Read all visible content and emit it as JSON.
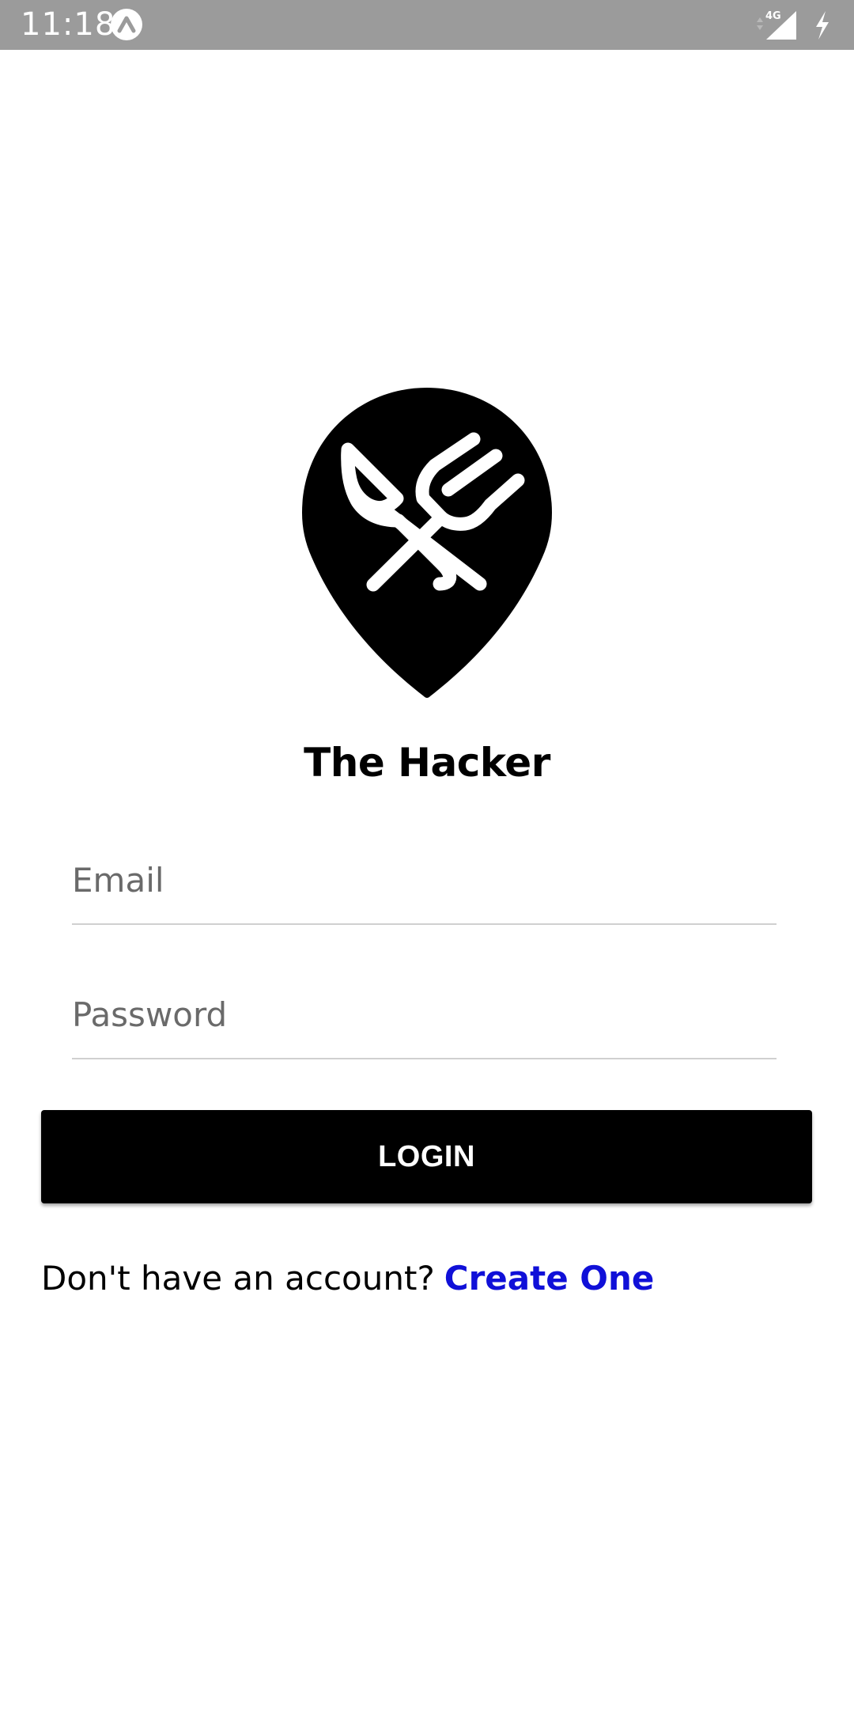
{
  "status_bar": {
    "time": "11:18",
    "network_label": "4G"
  },
  "app": {
    "title": "The Hacker"
  },
  "form": {
    "email_placeholder": "Email",
    "password_placeholder": "Password",
    "login_label": "LOGIN"
  },
  "signup": {
    "prompt": "Don't have an account?",
    "link_label": "Create One"
  },
  "colors": {
    "status_bar": "#9b9b9b",
    "primary": "#000000",
    "link": "#1010d8"
  },
  "icons": {
    "status_app": "expo-caret-icon",
    "network": "signal-4g-icon",
    "battery": "charging-bolt-icon",
    "logo": "fork-knife-location-pin-icon"
  }
}
